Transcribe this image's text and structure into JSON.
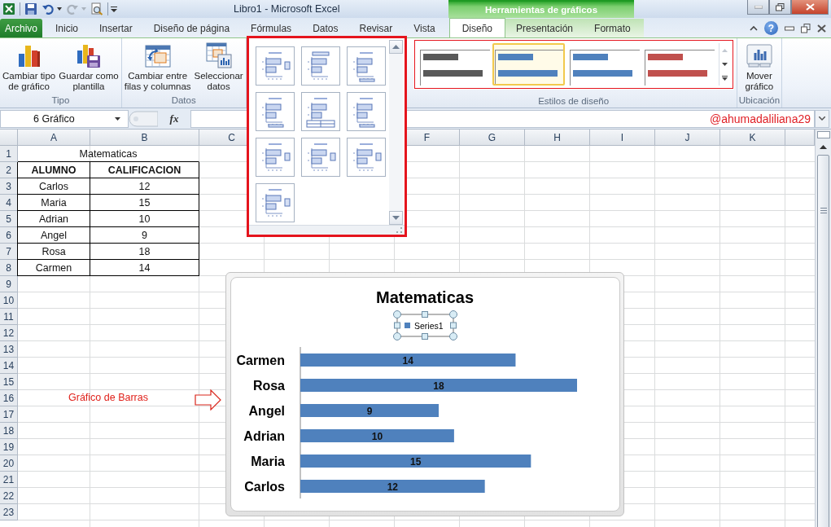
{
  "window": {
    "title": "Libro1  -  Microsoft Excel",
    "context_group": "Herramientas de gráficos",
    "help": "?"
  },
  "file_tab": {
    "label": "Archivo"
  },
  "tabs": [
    {
      "label": "Inicio",
      "selected": false,
      "contextual": false
    },
    {
      "label": "Insertar",
      "selected": false,
      "contextual": false
    },
    {
      "label": "Diseño de página",
      "selected": false,
      "contextual": false
    },
    {
      "label": "Fórmulas",
      "selected": false,
      "contextual": false
    },
    {
      "label": "Datos",
      "selected": false,
      "contextual": false
    },
    {
      "label": "Revisar",
      "selected": false,
      "contextual": false
    },
    {
      "label": "Vista",
      "selected": false,
      "contextual": false
    },
    {
      "label": "Diseño",
      "selected": true,
      "contextual": true
    },
    {
      "label": "Presentación",
      "selected": false,
      "contextual": true
    },
    {
      "label": "Formato",
      "selected": false,
      "contextual": true
    }
  ],
  "ribbon": {
    "groups": [
      {
        "kind": "buttons",
        "label": "Tipo",
        "buttons": [
          {
            "kind": "change-type",
            "label": "Cambiar tipo\nde gráfico"
          },
          {
            "kind": "save-template",
            "label": "Guardar como\nplantilla"
          }
        ]
      },
      {
        "kind": "buttons",
        "label": "Datos",
        "buttons": [
          {
            "kind": "switch",
            "label": "Cambiar entre\nfilas y columnas"
          },
          {
            "kind": "select-data",
            "label": "Seleccionar\ndatos"
          }
        ]
      },
      {
        "kind": "layouts",
        "expanded": true,
        "items": [
          {
            "kind": "legend-right"
          },
          {
            "kind": "legend-top"
          },
          {
            "kind": "legend-bottom"
          },
          {
            "kind": "legend-bottom"
          },
          {
            "kind": "table"
          },
          {
            "kind": "legend-bottom"
          },
          {
            "kind": "legend-right"
          },
          {
            "kind": "legend-right"
          },
          {
            "kind": "legend-right"
          },
          {
            "kind": "legend-right"
          }
        ]
      },
      {
        "kind": "styles",
        "label": "Estilos de diseño",
        "styles": [
          {
            "color": "#595959",
            "selected": false
          },
          {
            "color": "#4f81bd",
            "selected": true
          },
          {
            "color": "#4f81bd",
            "selected": false
          },
          {
            "color": "#c0504d",
            "selected": false
          }
        ]
      },
      {
        "kind": "buttons",
        "label": "Ubicación",
        "buttons": [
          {
            "kind": "move",
            "label": "Mover\ngráfico"
          }
        ]
      }
    ]
  },
  "formula_bar": {
    "name_box": "6 Gráfico",
    "function_label": "fx"
  },
  "annotations": [
    {
      "kind": "handle",
      "text": "@ahumadaliliana29"
    },
    {
      "kind": "callout",
      "text": "Gráfico de Barras"
    }
  ],
  "sheet": {
    "columns_left": [
      "A",
      "B",
      "C"
    ],
    "columns_right": [
      "F",
      "G",
      "H",
      "I",
      "J",
      "K"
    ],
    "rows": [
      {
        "number": "1",
        "cells": [
          {
            "kind": "merged",
            "text": "Matematicas"
          }
        ]
      },
      {
        "number": "2",
        "cells": [
          {
            "kind": "header",
            "text": "ALUMNO"
          },
          {
            "kind": "header",
            "text": "CALIFICACION"
          }
        ]
      },
      {
        "number": "3",
        "cells": [
          {
            "kind": "data",
            "text": "Carlos"
          },
          {
            "kind": "data",
            "text": "12"
          }
        ]
      },
      {
        "number": "4",
        "cells": [
          {
            "kind": "data",
            "text": "Maria"
          },
          {
            "kind": "data",
            "text": "15"
          }
        ]
      },
      {
        "number": "5",
        "cells": [
          {
            "kind": "data",
            "text": "Adrian"
          },
          {
            "kind": "data",
            "text": "10"
          }
        ]
      },
      {
        "number": "6",
        "cells": [
          {
            "kind": "data",
            "text": "Angel"
          },
          {
            "kind": "data",
            "text": "9"
          }
        ]
      },
      {
        "number": "7",
        "cells": [
          {
            "kind": "data",
            "text": "Rosa"
          },
          {
            "kind": "data",
            "text": "18"
          }
        ]
      },
      {
        "number": "8",
        "cells": [
          {
            "kind": "data",
            "text": "Carmen"
          },
          {
            "kind": "data",
            "text": "14"
          }
        ]
      },
      {
        "number": "9",
        "cells": []
      },
      {
        "number": "10",
        "cells": []
      },
      {
        "number": "11",
        "cells": []
      },
      {
        "number": "12",
        "cells": []
      },
      {
        "number": "13",
        "cells": []
      },
      {
        "number": "14",
        "cells": []
      },
      {
        "number": "15",
        "cells": []
      },
      {
        "number": "16",
        "cells": []
      },
      {
        "number": "17",
        "cells": []
      },
      {
        "number": "18",
        "cells": []
      },
      {
        "number": "19",
        "cells": []
      },
      {
        "number": "20",
        "cells": []
      },
      {
        "number": "21",
        "cells": []
      },
      {
        "number": "22",
        "cells": []
      },
      {
        "number": "23",
        "cells": []
      }
    ]
  },
  "chart": {
    "legend_selected": true,
    "chart_data": {
      "type": "bar",
      "orientation": "horizontal",
      "title": "Matematicas",
      "categories": [
        "Carmen",
        "Rosa",
        "Angel",
        "Adrian",
        "Maria",
        "Carlos"
      ],
      "series": [
        {
          "name": "Series1",
          "color": "#4f81bd",
          "values": [
            14,
            18,
            9,
            10,
            15,
            12
          ]
        }
      ],
      "data_labels": true
    }
  }
}
